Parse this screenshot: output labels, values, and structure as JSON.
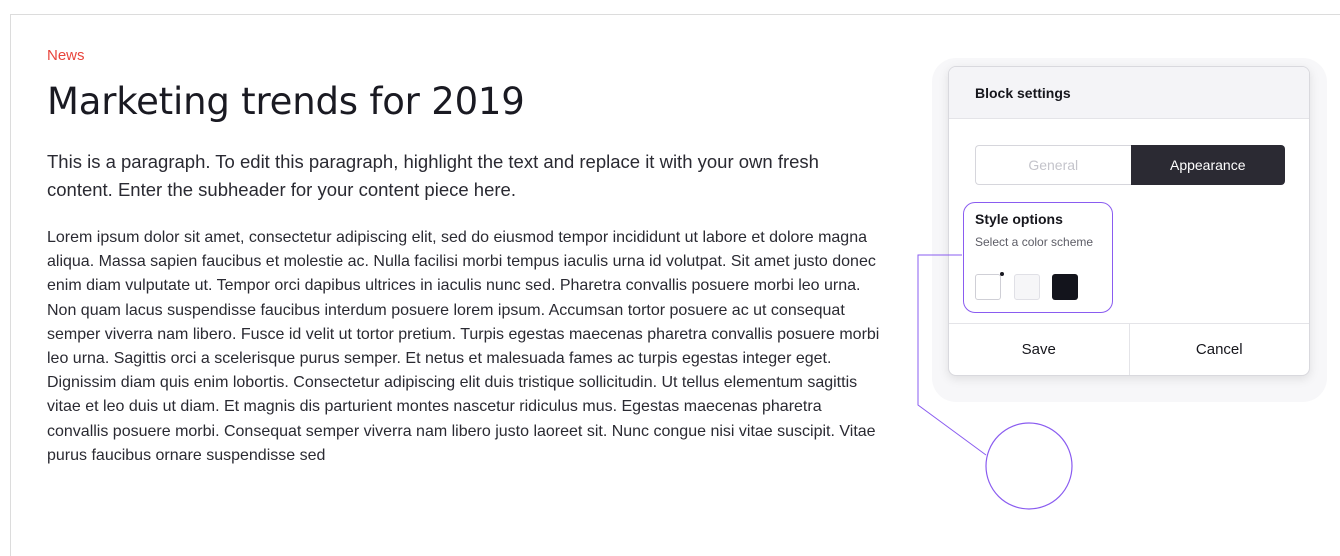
{
  "article": {
    "kicker": "News",
    "headline": "Marketing trends for 2019",
    "lede": "This is a paragraph. To edit this paragraph, highlight the text and replace it with your own fresh content. Enter the subheader for your content piece here.",
    "body": "Lorem ipsum dolor sit amet, consectetur adipiscing elit, sed do eiusmod tempor incididunt ut labore et dolore magna aliqua. Massa sapien faucibus et molestie ac. Nulla facilisi morbi tempus iaculis urna id volutpat. Sit amet justo donec enim diam vulputate ut. Tempor orci dapibus ultrices in iaculis nunc sed. Pharetra convallis posuere morbi leo urna. Non quam lacus suspendisse faucibus interdum posuere lorem ipsum. Accumsan tortor posuere ac ut consequat semper viverra nam libero. Fusce id velit ut tortor pretium. Turpis egestas maecenas pharetra convallis posuere morbi leo urna. Sagittis orci a scelerisque purus semper. Et netus et malesuada fames ac turpis egestas integer eget. Dignissim diam quis enim lobortis. Consectetur adipiscing elit duis tristique sollicitudin. Ut tellus elementum sagittis vitae et leo duis ut diam. Et magnis dis parturient montes nascetur ridiculus mus. Egestas maecenas pharetra convallis posuere morbi. Consequat semper viverra nam libero justo laoreet sit. Nunc congue nisi vitae suscipit. Vitae purus faucibus ornare suspendisse sed"
  },
  "panel": {
    "title": "Block settings",
    "tabs": [
      {
        "label": "General",
        "active": false
      },
      {
        "label": "Appearance",
        "active": true
      }
    ],
    "style_options": {
      "title": "Style options",
      "subtitle": "Select a color scheme",
      "swatches": [
        {
          "name": "white",
          "color": "#ffffff"
        },
        {
          "name": "light-gray",
          "color": "#f6f6f8"
        },
        {
          "name": "black",
          "color": "#13141c"
        }
      ]
    },
    "buttons": {
      "save": "Save",
      "cancel": "Cancel"
    }
  },
  "colors": {
    "accent_kicker": "#e8453c",
    "highlight_purple": "#8a5cf0",
    "active_tab_bg": "#2b2a33"
  }
}
